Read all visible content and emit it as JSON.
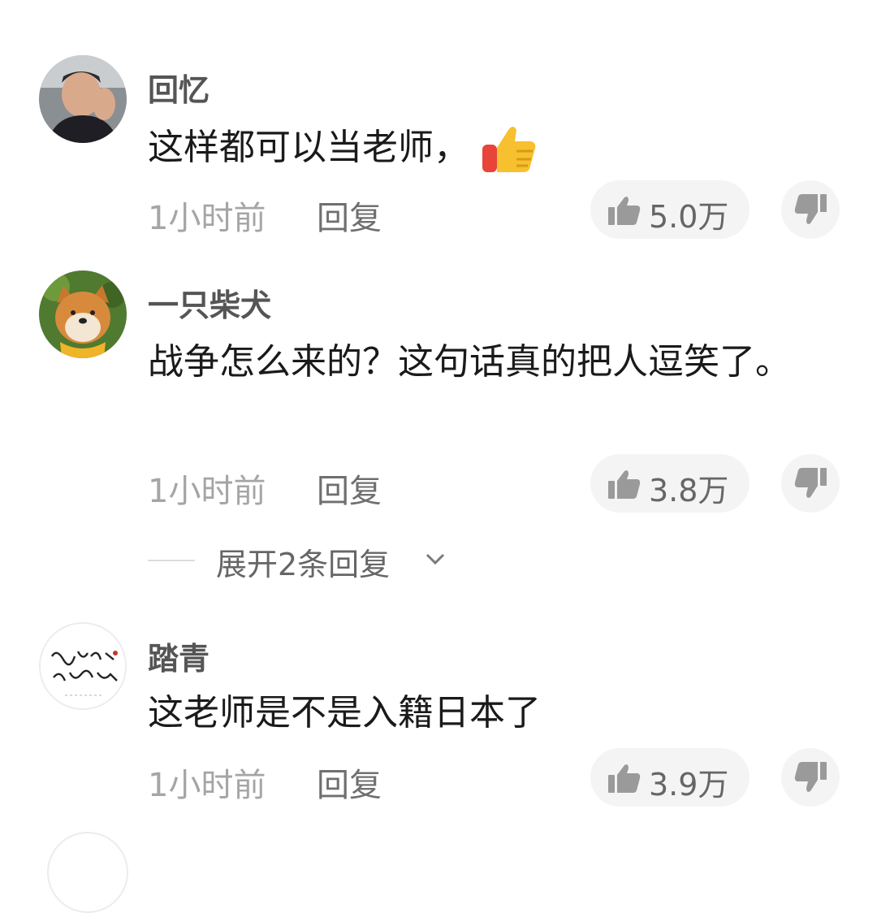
{
  "comments": [
    {
      "username": "回忆",
      "text": "这样都可以当老师，",
      "emoji": "thumbs-up",
      "time": "1小时前",
      "reply_label": "回复",
      "likes": "5.0万"
    },
    {
      "username": "一只柴犬",
      "text": "战争怎么来的？这句话真的把人逗笑了。",
      "time": "1小时前",
      "reply_label": "回复",
      "likes": "3.8万",
      "expand_label": "展开2条回复"
    },
    {
      "username": "踏青",
      "text": "这老师是不是入籍日本了",
      "time": "1小时前",
      "reply_label": "回复",
      "likes": "3.9万"
    }
  ],
  "icons": {
    "like": "thumbs-up-icon",
    "dislike": "thumbs-down-icon",
    "expand": "chevron-down-icon"
  },
  "colors": {
    "pill_background": "#f4f4f4",
    "meta_text": "#a5a5a5",
    "username_text": "#555555"
  }
}
